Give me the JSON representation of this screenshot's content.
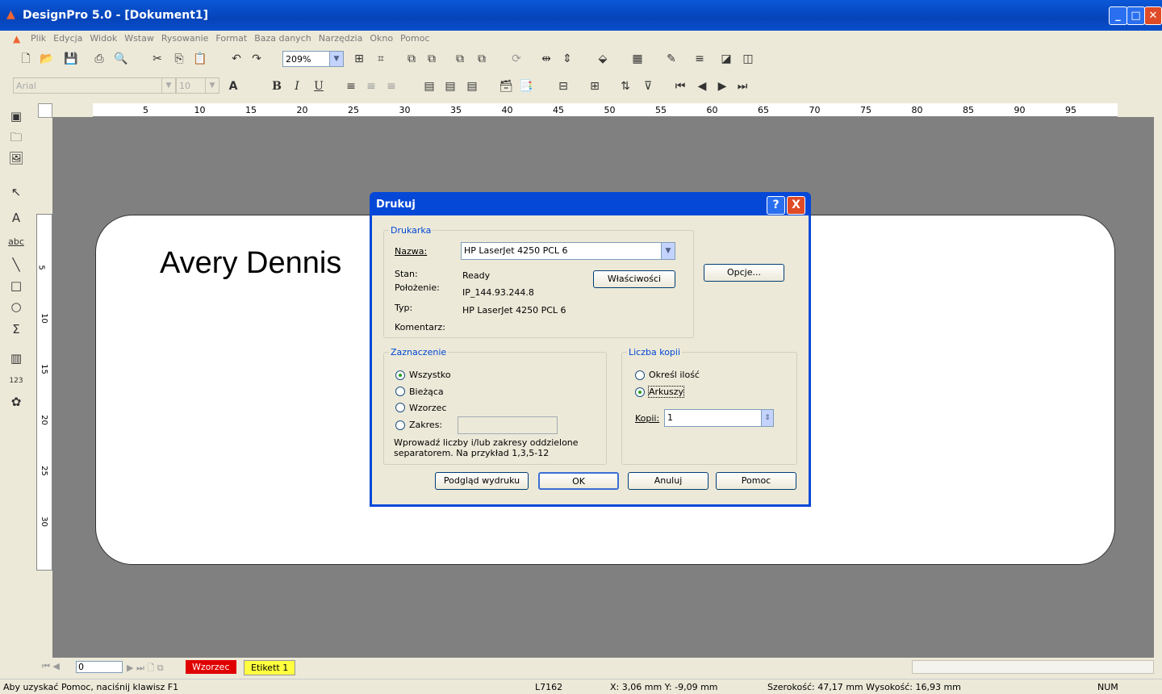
{
  "window": {
    "title": "DesignPro 5.0 - [Dokument1]"
  },
  "menu": [
    "Plik",
    "Edycja",
    "Widok",
    "Wstaw",
    "Rysowanie",
    "Format",
    "Baza danych",
    "Narzędzia",
    "Okno",
    "Pomoc"
  ],
  "toolbar": {
    "zoom": "209%",
    "font": "Arial",
    "size": "10",
    "bold": "B",
    "italic": "I",
    "underline": "U",
    "color_a": "A"
  },
  "ruler": {
    "h": [
      "5",
      "10",
      "15",
      "20",
      "25",
      "30",
      "35",
      "40",
      "45",
      "50",
      "55",
      "60",
      "65",
      "70",
      "75",
      "80",
      "85",
      "90",
      "95"
    ],
    "v": [
      "5",
      "10",
      "15",
      "20",
      "25",
      "30"
    ]
  },
  "label": {
    "text": "Avery Dennis"
  },
  "dialog": {
    "title": "Drukuj",
    "help_btn": "?",
    "close_btn": "X",
    "printer": {
      "legend": "Drukarka",
      "name_label": "Nazwa:",
      "name_value": "HP LaserJet 4250 PCL 6",
      "status_label": "Stan:",
      "status_value": "Ready",
      "location_label": "Położenie:",
      "location_value": "IP_144.93.244.8",
      "type_label": "Typ:",
      "type_value": "HP LaserJet 4250 PCL 6",
      "comment_label": "Komentarz:",
      "properties_btn": "Właściwości"
    },
    "options_btn": "Opcje...",
    "selection": {
      "legend": "Zaznaczenie",
      "all": "Wszystko",
      "current": "Bieżąca",
      "template": "Wzorzec",
      "range": "Zakres:",
      "hint": "Wprowadź liczby i/lub zakresy oddzielone separatorem.  Na przykład 1,3,5-12"
    },
    "copies": {
      "legend": "Liczba kopii",
      "specify": "Określ ilość",
      "sheets": "Arkuszy",
      "copies_label": "Kopii:",
      "copies_value": "1"
    },
    "buttons": {
      "preview": "Podgląd wydruku",
      "ok": "OK",
      "cancel": "Anuluj",
      "help": "Pomoc"
    }
  },
  "tabs": {
    "page": "0",
    "tab1": "Wzorzec",
    "tab2": "Etikett 1"
  },
  "status": {
    "hint": "Aby uzyskać Pomoc, naciśnij klawisz F1",
    "code": "L7162",
    "coords": "X: 3,06 mm  Y: -9,09 mm",
    "size": "Szerokość: 47,17 mm  Wysokość: 16,93 mm",
    "num": "NUM"
  }
}
